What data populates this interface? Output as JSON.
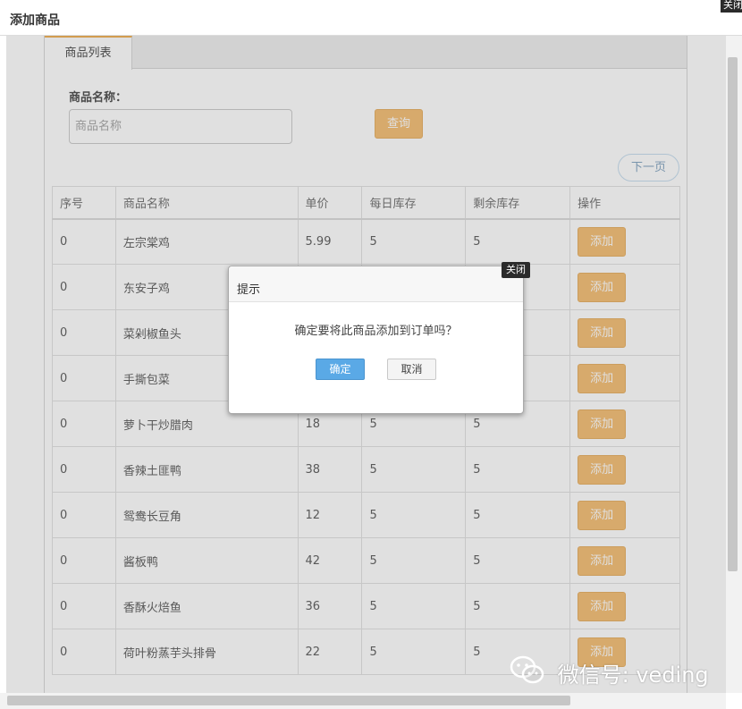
{
  "window": {
    "title": "添加商品",
    "close_label": "关闭"
  },
  "tab": {
    "label": "商品列表"
  },
  "filter": {
    "label": "商品名称：",
    "placeholder": "商品名称",
    "value": ""
  },
  "query_button": "查询",
  "next_page": "下一页",
  "table": {
    "columns": [
      "序号",
      "商品名称",
      "单价",
      "每日库存",
      "剩余库存",
      "操作"
    ],
    "rows": [
      {
        "seq": "0",
        "name": "左宗棠鸡",
        "price": "5.99",
        "daily": "5",
        "remaining": "5",
        "action": "添加"
      },
      {
        "seq": "0",
        "name": "东安子鸡",
        "price": "",
        "daily": "",
        "remaining": "",
        "action": "添加"
      },
      {
        "seq": "0",
        "name": "菜剁椒鱼头",
        "price": "",
        "daily": "",
        "remaining": "",
        "action": "添加"
      },
      {
        "seq": "0",
        "name": "手撕包菜",
        "price": "",
        "daily": "",
        "remaining": "",
        "action": "添加"
      },
      {
        "seq": "0",
        "name": "萝卜干炒腊肉",
        "price": "18",
        "daily": "5",
        "remaining": "5",
        "action": "添加"
      },
      {
        "seq": "0",
        "name": "香辣土匪鸭",
        "price": "38",
        "daily": "5",
        "remaining": "5",
        "action": "添加"
      },
      {
        "seq": "0",
        "name": "鸳鸯长豆角",
        "price": "12",
        "daily": "5",
        "remaining": "5",
        "action": "添加"
      },
      {
        "seq": "0",
        "name": "酱板鸭",
        "price": "42",
        "daily": "5",
        "remaining": "5",
        "action": "添加"
      },
      {
        "seq": "0",
        "name": "香酥火焙鱼",
        "price": "36",
        "daily": "5",
        "remaining": "5",
        "action": "添加"
      },
      {
        "seq": "0",
        "name": "荷叶粉蒸芋头排骨",
        "price": "22",
        "daily": "5",
        "remaining": "5",
        "action": "添加"
      }
    ]
  },
  "modal": {
    "title": "提示",
    "close_label": "关闭",
    "message": "确定要将此商品添加到订单吗？",
    "ok_label": "确定",
    "cancel_label": "取消"
  },
  "watermark": {
    "text": "微信号: veding",
    "icon": "wechat-icon"
  },
  "colors": {
    "accent_orange": "#f5c27c",
    "primary_blue": "#5aa9e6",
    "tab_accent": "#f0b25a"
  }
}
